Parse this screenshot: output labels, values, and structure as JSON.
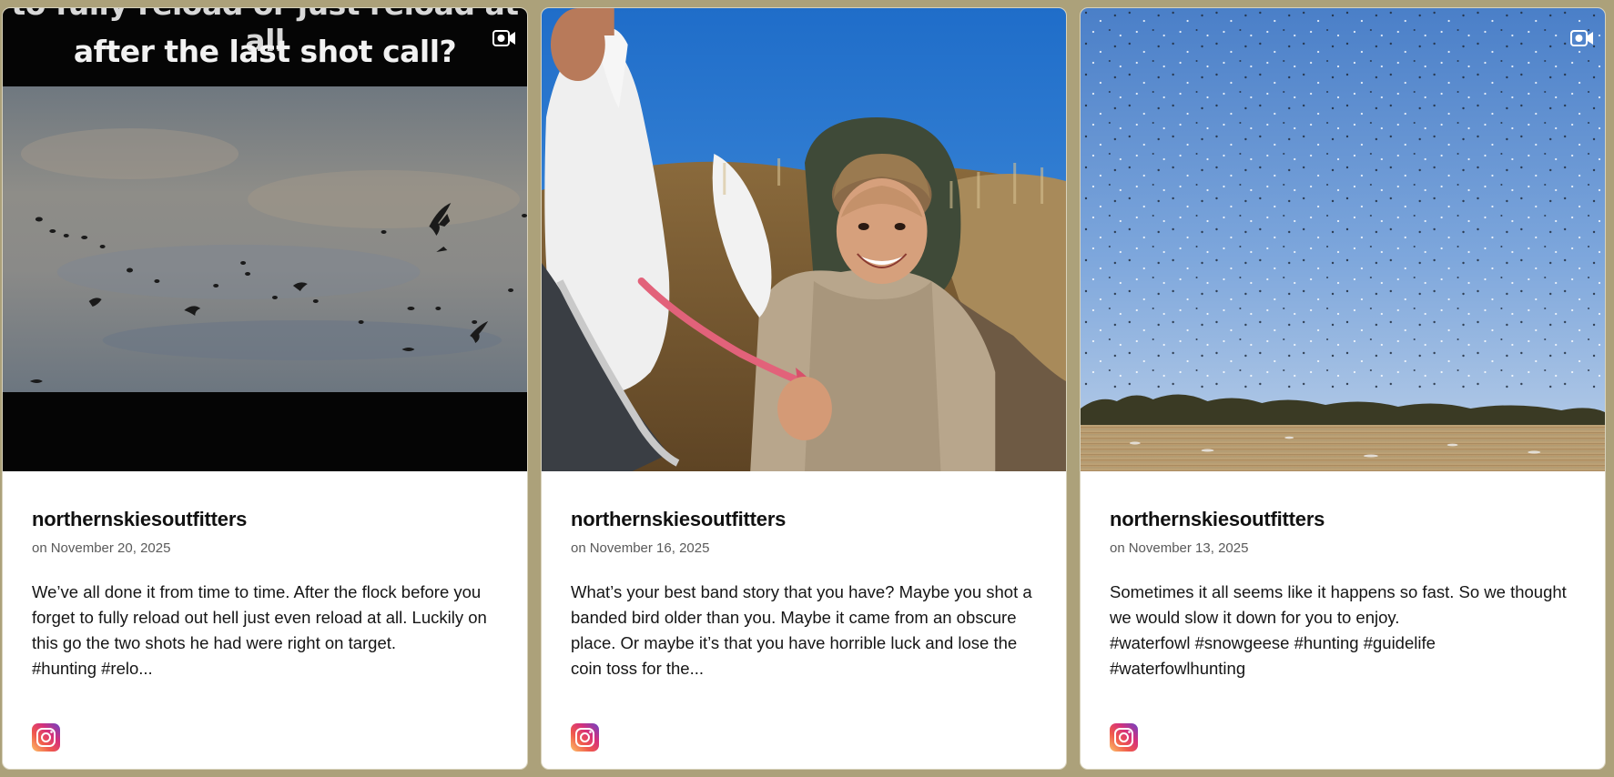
{
  "posts": [
    {
      "overlay_top": "to fully reload or just reload at all",
      "overlay_main": "after the last shot call?",
      "media_type": "video",
      "media_icon": "video-camera-icon",
      "author": "northernskiesoutfitters",
      "date_prefix": "on",
      "date": "November 20, 2025",
      "caption": "We’ve all done it from time to time. After the flock before you\nforget to fully reload out hell just even reload at all. Luckily on\nthis go the two shots he had were right on target.\n#hunting #relo...",
      "source_icon": "instagram-icon"
    },
    {
      "media_type": "image",
      "author": "northernskiesoutfitters",
      "date_prefix": "on",
      "date": "November 16, 2025",
      "caption": "What’s your best band story that you have? Maybe you shot a\nbanded bird older than you. Maybe it came from an obscure\nplace. Or maybe it’s that you have horrible luck and lose the\ncoin toss for the...",
      "source_icon": "instagram-icon"
    },
    {
      "media_type": "video",
      "media_icon": "video-camera-icon",
      "author": "northernskiesoutfitters",
      "date_prefix": "on",
      "date": "November 13, 2025",
      "caption": "Sometimes it all seems like it happens so fast. So we thought\nwe would slow it down for you to enjoy.\n#waterfowl #snowgeese #hunting #guidelife\n#waterfowlhunting",
      "source_icon": "instagram-icon"
    }
  ],
  "colors": {
    "page_background": "#aca17a",
    "card_background": "#ffffff",
    "author_text": "#111111",
    "date_text": "#5a5a5a"
  }
}
